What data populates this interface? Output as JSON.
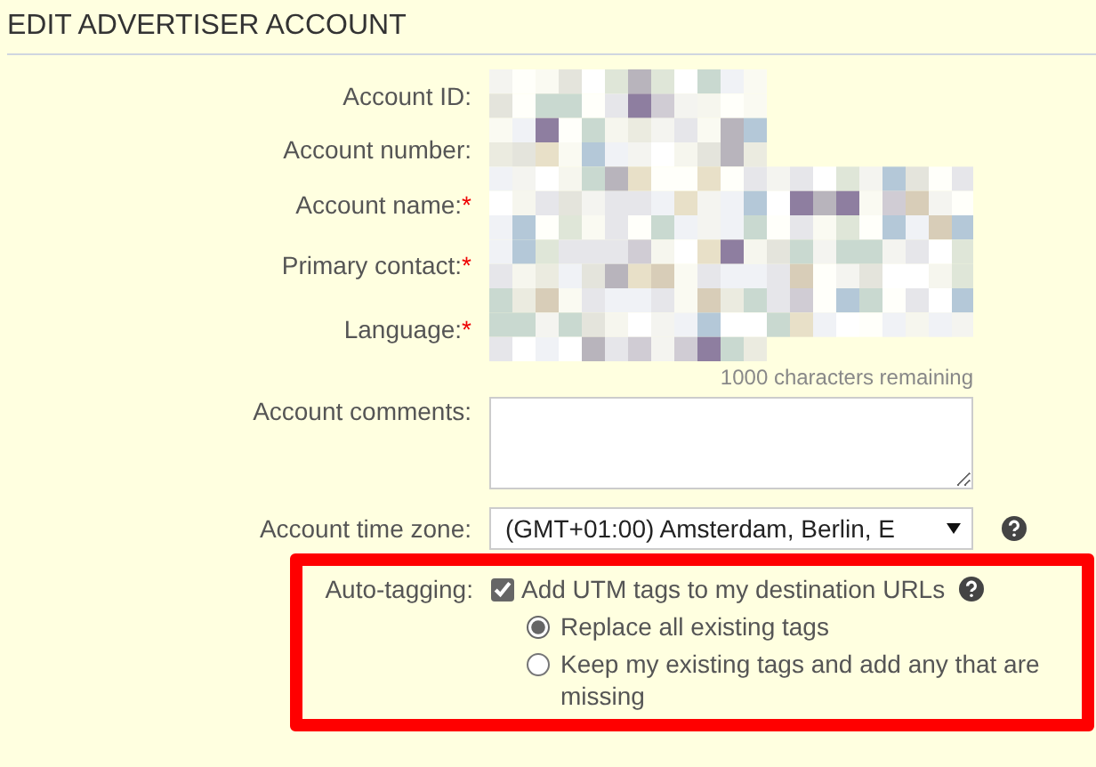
{
  "title": "EDIT ADVERTISER ACCOUNT",
  "fields": [
    {
      "label": "Account ID:"
    },
    {
      "label": "Account number:"
    },
    {
      "label": "Account name:",
      "required_mark": "*"
    },
    {
      "label": "Primary contact:",
      "required_mark": "*"
    },
    {
      "label": "Language:",
      "required_mark": "*"
    }
  ],
  "comments": {
    "label": "Account comments:",
    "counter": "1000 characters remaining"
  },
  "time_zone": {
    "label": "Account time zone:",
    "value": "(GMT+01:00) Amsterdam, Berlin, E"
  },
  "auto_tagging": {
    "label": "Auto-tagging:",
    "highlighted": true,
    "checkbox": {
      "label": "Add UTM tags to my destination URLs",
      "checked": true
    },
    "options": [
      {
        "label": "Replace all existing tags",
        "selected": true
      },
      {
        "label": "Keep my existing tags and add any that are missing",
        "selected": false
      }
    ]
  }
}
